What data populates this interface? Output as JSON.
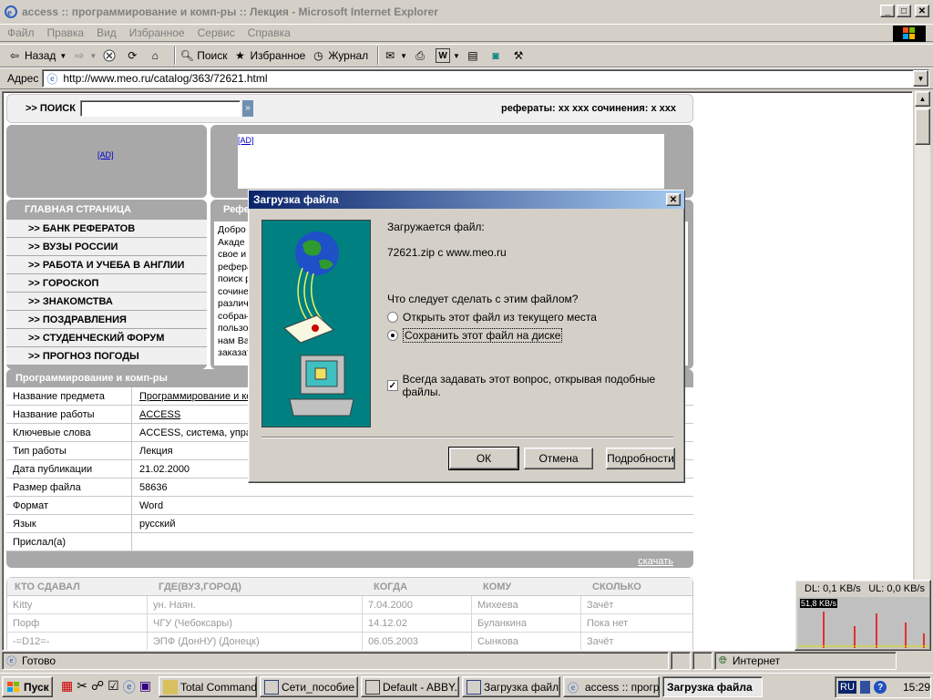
{
  "window": {
    "title": "access :: программирование и комп-ры :: Лекция - Microsoft Internet Explorer"
  },
  "menu": [
    "Файл",
    "Правка",
    "Вид",
    "Избранное",
    "Сервис",
    "Справка"
  ],
  "toolbar": {
    "back": "Назад",
    "search": "Поиск",
    "favorites": "Избранное",
    "history": "Журнал"
  },
  "address": {
    "label": "Адрес",
    "url": "http://www.meo.ru/catalog/363/72621.html"
  },
  "page": {
    "search_label": ">> ПОИСК",
    "search_go": "»",
    "top_right": "рефераты: хх ххх сочинения: х ххх",
    "ad1": "[AD]",
    "ad2": "[AD]",
    "nav_header": "ГЛАВНАЯ СТРАНИЦА",
    "nav": [
      ">> БАНК РЕФЕРАТОВ",
      ">> ВУЗЫ РОССИИ",
      ">> РАБОТА И УЧЕБА В АНГЛИИ",
      ">> ГОРОСКОП",
      ">> ЗНАКОМСТВА",
      ">> ПОЗДРАВЛЕНИЯ",
      ">> СТУДЕНЧЕСКИЙ ФОРУМ",
      ">> ПРОГНОЗ ПОГОДЫ"
    ],
    "ref_header": "Рефе",
    "ref_text": [
      "Добро",
      "Акаде",
      "свое и",
      "рефера",
      "поиск р",
      "сочине",
      "различ",
      "собран",
      "пользо",
      "нам Ва",
      "заказат"
    ],
    "section_title": "Программирование и комп-ры",
    "details": [
      {
        "k": "Название предмета",
        "v": "Программирование и ко"
      },
      {
        "k": "Название работы",
        "v": "ACCESS"
      },
      {
        "k": "Ключевые слова",
        "v": "ACCESS, система, упра"
      },
      {
        "k": "Тип работы",
        "v": "Лекция"
      },
      {
        "k": "Дата публикации",
        "v": "21.02.2000"
      },
      {
        "k": "Размер файла",
        "v": "58636"
      },
      {
        "k": "Формат",
        "v": "Word"
      },
      {
        "k": "Язык",
        "v": "русский"
      },
      {
        "k": "Прислал(а)",
        "v": ""
      }
    ],
    "download": "скачать",
    "hist_headers": [
      "КТО СДАВАЛ",
      "ГДЕ(ВУЗ,ГОРОД)",
      "КОГДА",
      "КОМУ",
      "СКОЛЬКО"
    ],
    "hist_rows": [
      [
        "Kitty",
        "ун. Наян.",
        "7.04.2000",
        "Михеева",
        "Зачёт"
      ],
      [
        "Порф",
        "ЧГУ (Чебоксары)",
        "14.12.02",
        "Буланкина",
        "Пока нет"
      ],
      [
        "-=D12=-",
        "ЭПФ (ДонНУ) (Донецк)",
        "06.05.2003",
        "Сынкова",
        "Зачёт"
      ]
    ]
  },
  "dialog": {
    "title": "Загрузка файла",
    "downloading": "Загружается файл:",
    "filename": "72621.zip с www.meo.ru",
    "question": "Что следует сделать с этим файлом?",
    "opt_open": "Открыть этот файл из текущего места",
    "opt_save": "Сохранить этот файл на диске",
    "always_ask": "Всегда задавать этот вопрос, открывая подобные файлы.",
    "ok": "ОК",
    "cancel": "Отмена",
    "details": "Подробности"
  },
  "status": {
    "text": "Готово",
    "zone": "Интернет"
  },
  "netmon": {
    "dl": "DL: 0,1 KB/s",
    "ul": "UL: 0,0 KB/s",
    "scale": "51,8 KB/s"
  },
  "taskbar": {
    "start": "Пуск",
    "tasks": [
      "Total Command...",
      "Сети_пособие ...",
      "Default - ABBY...",
      "Загрузка файл...",
      "access :: прогр...",
      "Загрузка файла"
    ],
    "lang": "RU",
    "clock": "15:29"
  },
  "colors": {
    "title_active": "#0a246a",
    "title_grad": "#a6caf0",
    "panel": "#a8a8a8",
    "dialog_art": "#008080"
  }
}
